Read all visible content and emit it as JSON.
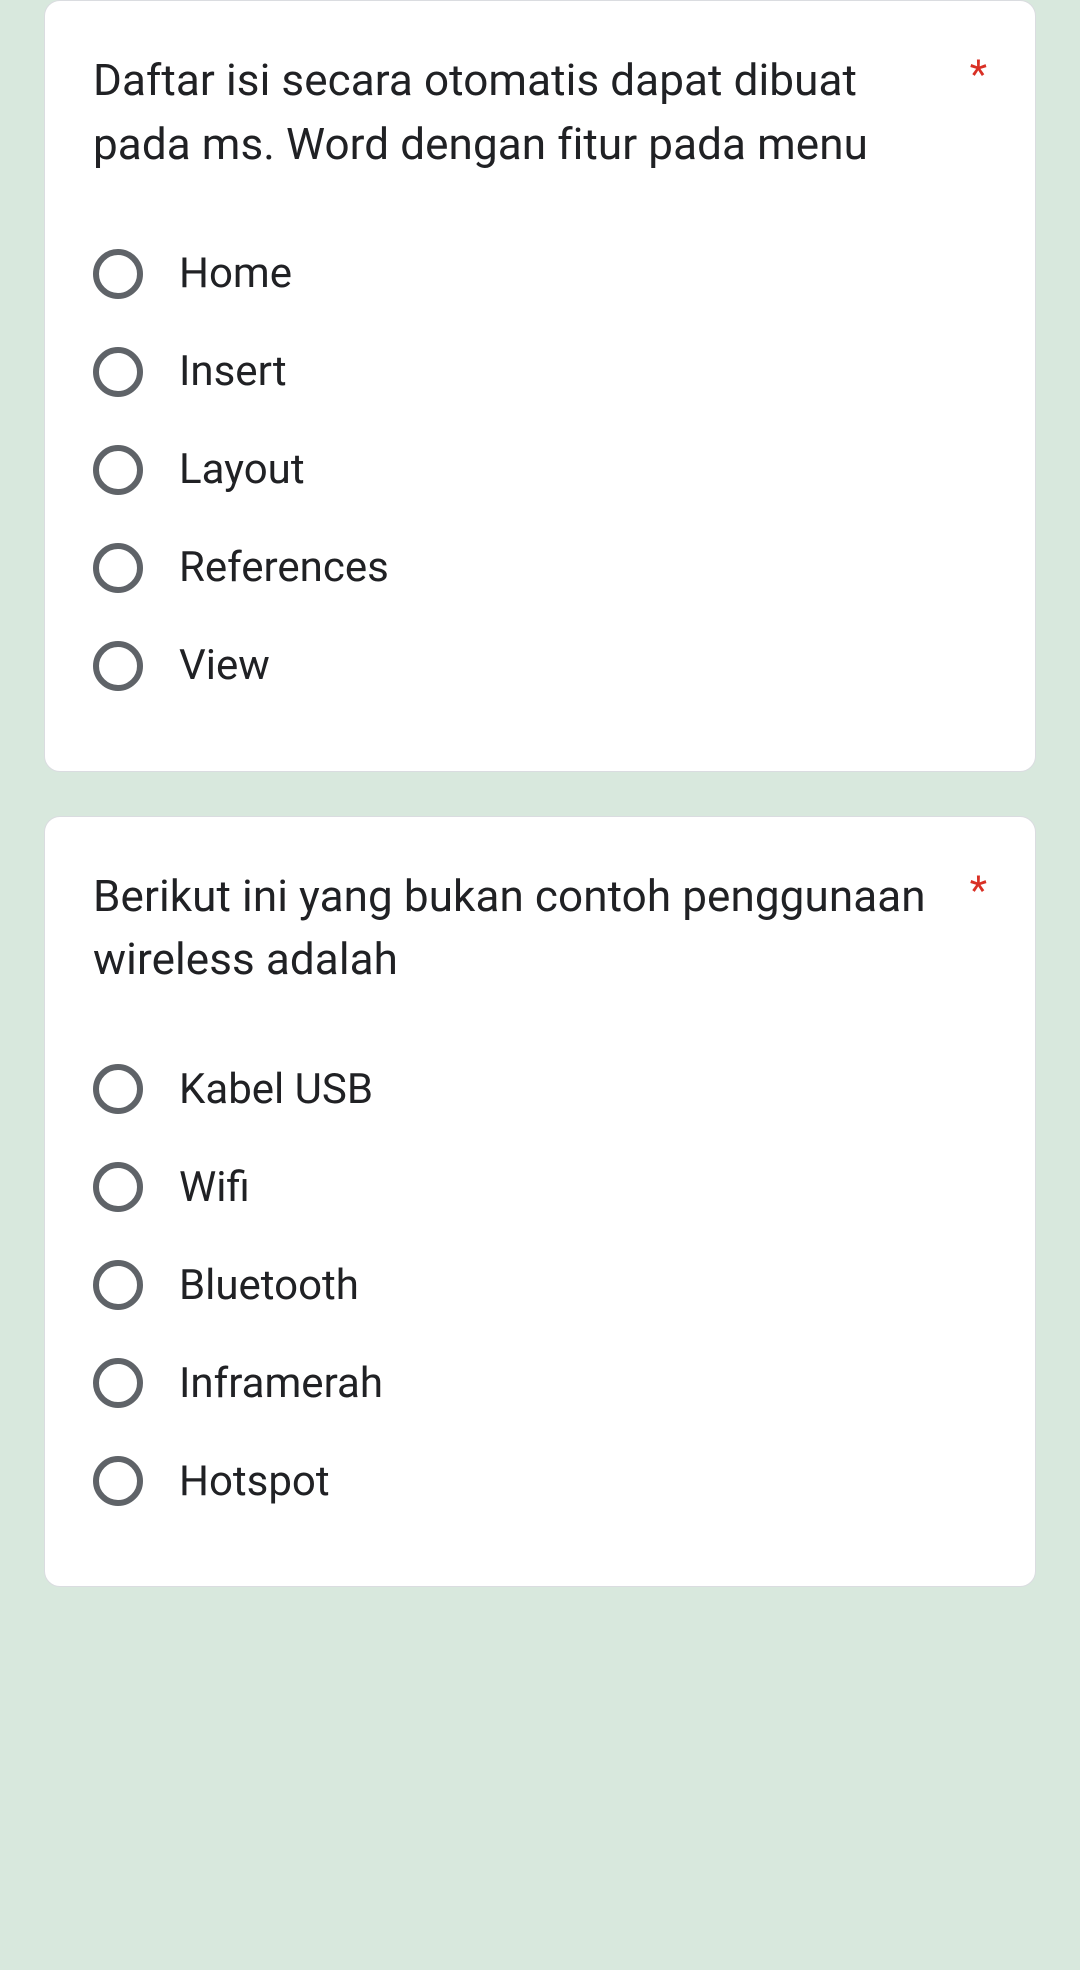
{
  "questions": [
    {
      "text": "Daftar isi secara otomatis dapat dibuat pada ms. Word dengan fitur pada menu",
      "required_marker": "*",
      "options": [
        {
          "label": "Home"
        },
        {
          "label": "Insert"
        },
        {
          "label": "Layout"
        },
        {
          "label": "References"
        },
        {
          "label": "View"
        }
      ]
    },
    {
      "text": "Berikut ini yang bukan contoh penggunaan wireless adalah",
      "required_marker": "*",
      "options": [
        {
          "label": "Kabel USB"
        },
        {
          "label": "Wifi"
        },
        {
          "label": "Bluetooth"
        },
        {
          "label": "Inframerah"
        },
        {
          "label": "Hotspot"
        }
      ]
    }
  ]
}
